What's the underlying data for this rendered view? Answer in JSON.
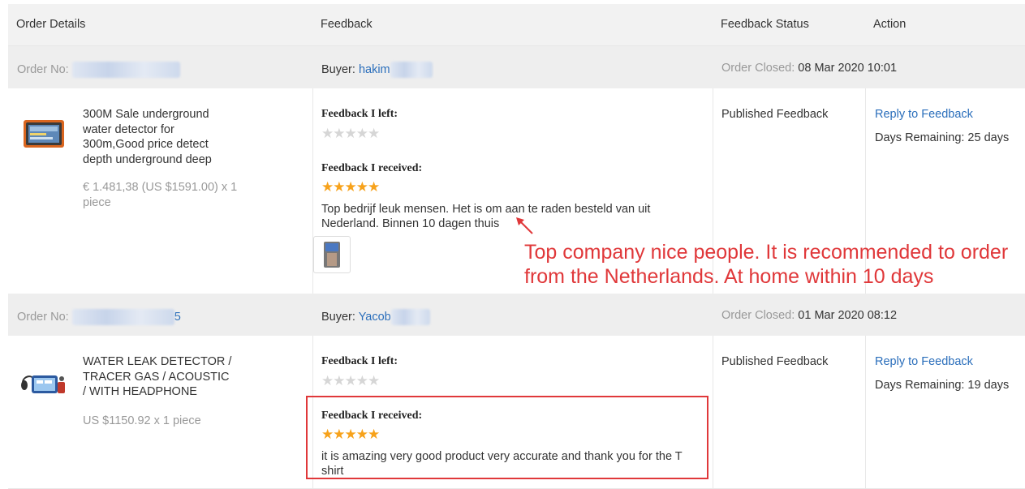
{
  "header": {
    "col_order": "Order Details",
    "col_feedback": "Feedback",
    "col_status": "Feedback Status",
    "col_action": "Action"
  },
  "orders": [
    {
      "order_no_label": "Order No:",
      "order_no_suffix": "",
      "buyer_label": "Buyer:",
      "buyer_name": "hakim",
      "closed_label": "Order Closed:",
      "closed_date": "08 Mar 2020 10:01",
      "product_title": "300M Sale underground water detector for 300m,Good price detect depth underground deep",
      "product_price": "€ 1.481,38 (US $1591.00) x 1 piece",
      "fb_left_label": "Feedback I left:",
      "fb_left_rating": 0,
      "fb_received_label": "Feedback I received:",
      "fb_received_rating": 5,
      "fb_received_text": "Top bedrijf leuk mensen. Het is om aan te raden besteld van uit Nederland. Binnen 10 dagen thuis",
      "status": "Published Feedback",
      "action_link": "Reply to Feedback",
      "days_remaining": "Days Remaining: 25 days"
    },
    {
      "order_no_label": "Order No:",
      "order_no_suffix": "5",
      "buyer_label": "Buyer:",
      "buyer_name": "Yacob",
      "closed_label": "Order Closed:",
      "closed_date": "01 Mar 2020 08:12",
      "product_title": "WATER LEAK DETECTOR / TRACER GAS / ACOUSTIC / WITH HEADPHONE",
      "product_price": "US $1150.92 x 1 piece",
      "fb_left_label": "Feedback I left:",
      "fb_left_rating": 0,
      "fb_received_label": "Feedback I received:",
      "fb_received_rating": 5,
      "fb_received_text": "it is amazing very good product very accurate and thank you for the T shirt",
      "status": "Published Feedback",
      "action_link": "Reply to Feedback",
      "days_remaining": "Days Remaining: 19 days"
    }
  ],
  "annotation": {
    "translation": "Top company nice people. It is recommended to order from the Netherlands. At home within 10 days",
    "color": "#e0383a"
  },
  "colors": {
    "link": "#2a6ebb",
    "star_full": "#f7a21b",
    "star_empty": "#d6d6d6",
    "header_bg": "#f2f2f2",
    "order_bar_bg": "#eeeeee"
  },
  "icons": {
    "star": "★"
  }
}
